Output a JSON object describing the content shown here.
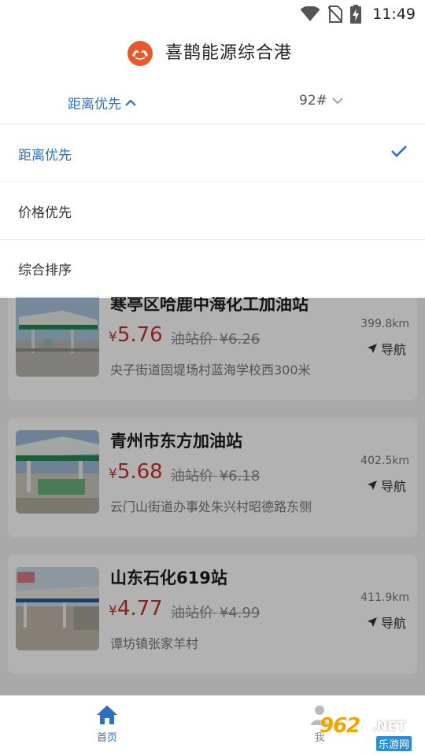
{
  "status_bar": {
    "time": "11:49"
  },
  "header": {
    "title": "喜鹊能源综合港",
    "logo_icon": "magpie-logo-icon"
  },
  "filter_bar": {
    "sort_label": "距离优先",
    "fuel_label": "92#"
  },
  "sort_menu": {
    "options": [
      {
        "label": "距离优先",
        "selected": true
      },
      {
        "label": "价格优先",
        "selected": false
      },
      {
        "label": "综合排序",
        "selected": false
      }
    ]
  },
  "stations": [
    {
      "name": "寒亭区哈鹿中海化工加油站",
      "currency": "¥",
      "price": "5.76",
      "orig_label": "油站价",
      "orig_price": "¥6.26",
      "address": "央子街道固堤场村蓝海学校西300米",
      "distance": "399.8km",
      "nav_label": "导航"
    },
    {
      "name": "青州市东方加油站",
      "currency": "¥",
      "price": "5.68",
      "orig_label": "油站价",
      "orig_price": "¥6.18",
      "address": "云门山街道办事处朱兴村昭德路东侧",
      "distance": "402.5km",
      "nav_label": "导航"
    },
    {
      "name": "山东石化619站",
      "currency": "¥",
      "price": "4.77",
      "orig_label": "油站价",
      "orig_price": "¥4.99",
      "address": "谭坊镇张家羊村",
      "distance": "411.9km",
      "nav_label": "导航"
    }
  ],
  "bottom_nav": {
    "home_label": "首页",
    "mine_label": "我"
  },
  "watermark": {
    "number": "962",
    "domain": ".NET",
    "site": "乐游网"
  },
  "colors": {
    "accent": "#2f6fbf",
    "price": "#c8332a",
    "logo": "#e7592b"
  }
}
